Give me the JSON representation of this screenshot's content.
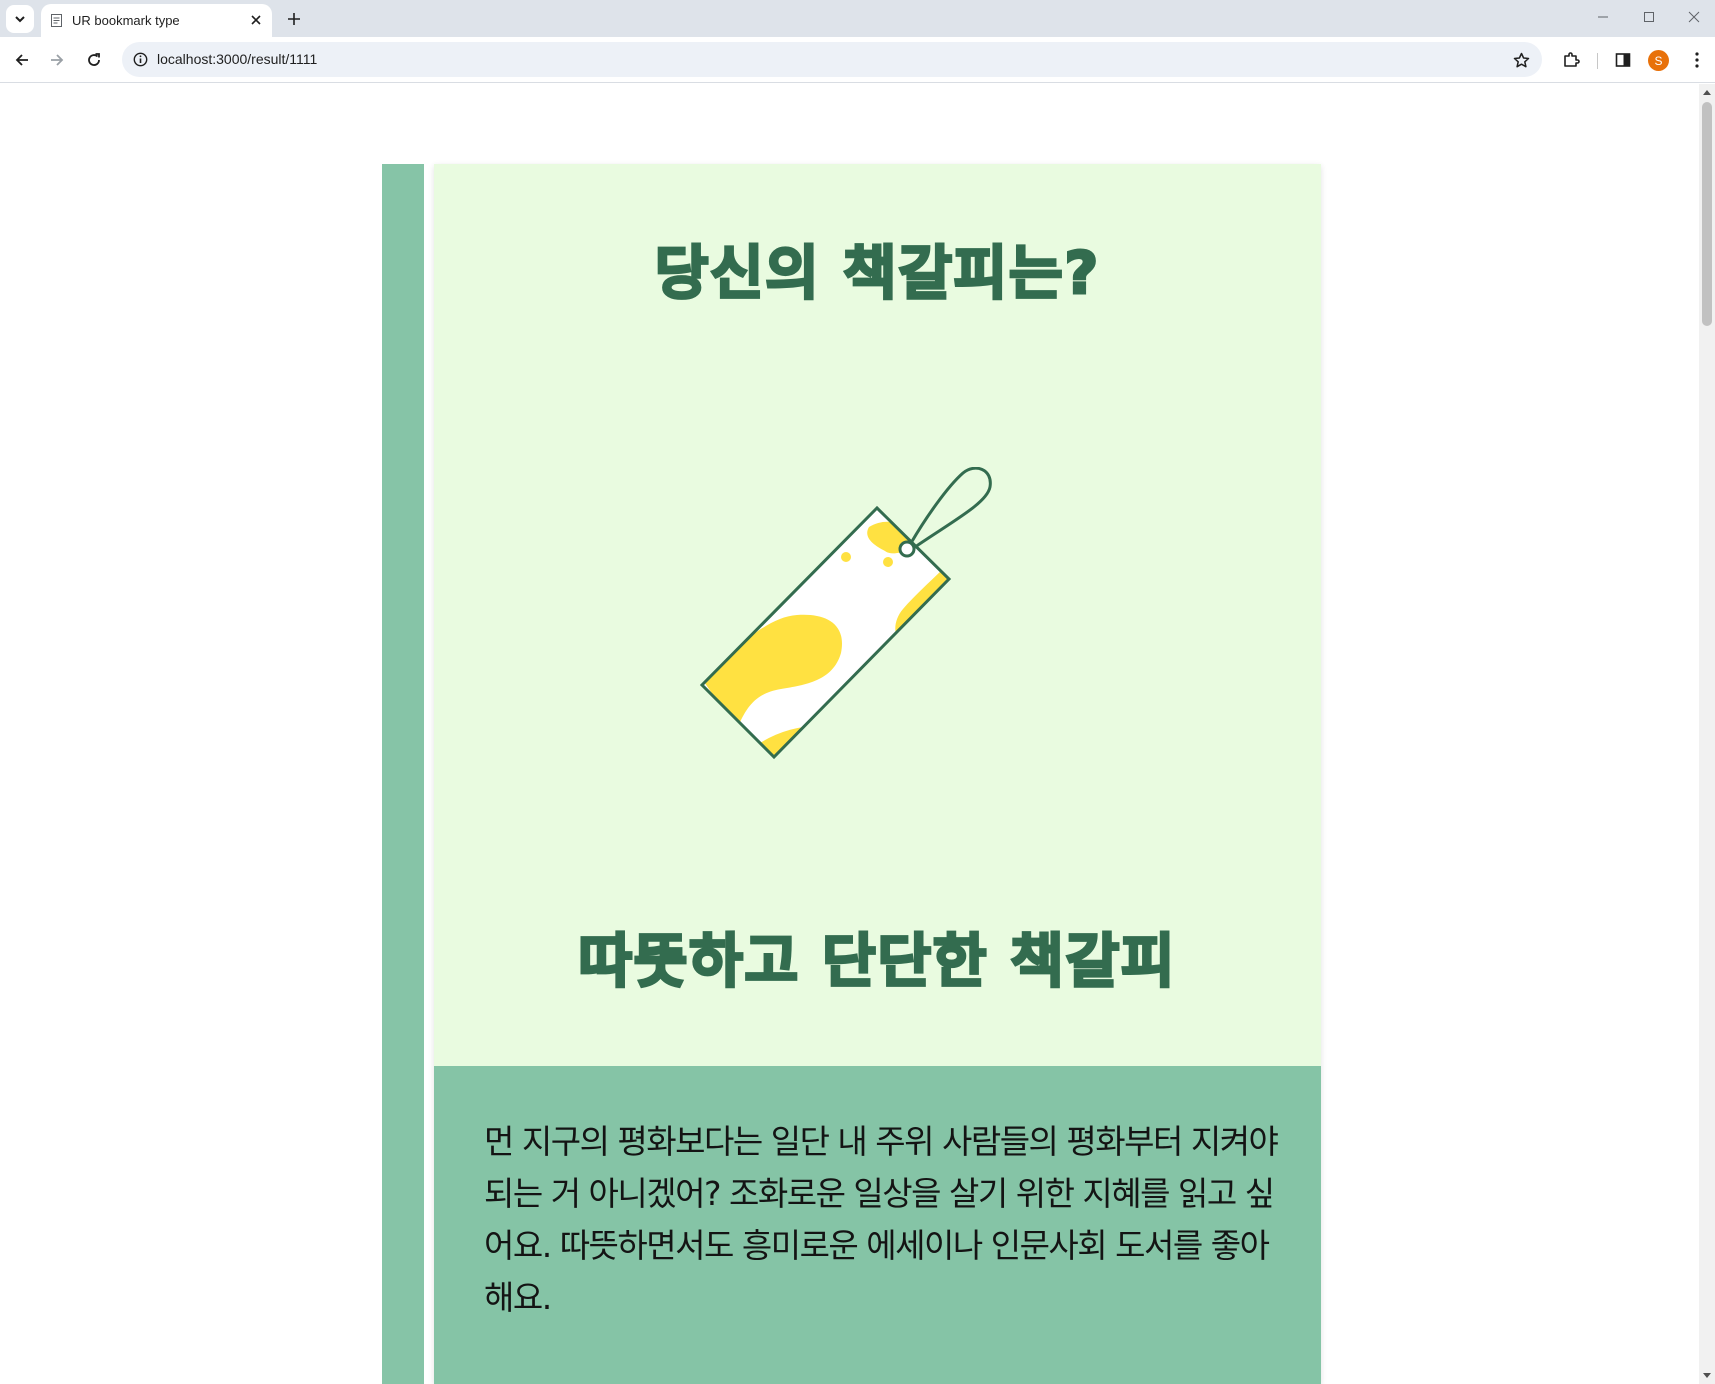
{
  "browser": {
    "tab_title": "UR bookmark type",
    "url": "localhost:3000/result/1111",
    "profile_initial": "S"
  },
  "page": {
    "title": "당신의 책갈피는?",
    "result_name": "따뜻하고 단단한 책갈피",
    "description": "먼 지구의 평화보다는 일단 내 주위 사람들의 평화부터 지켜야 되는 거 아니겠어? 조화로운 일상을 살기 위한 지혜를 읽고 싶어요. 따뜻하면서도 흥미로운 에세이나 인문사회 도서를 좋아해요."
  },
  "colors": {
    "card_background": "#e9fbe0",
    "spine": "#86c4a7",
    "accent_green": "#336c4f",
    "description_panel": "#85c4a6",
    "bookmark_yellow": "#ffe141"
  },
  "icons": {
    "bookmark_illustration": "bookmark-tag-illustration"
  }
}
